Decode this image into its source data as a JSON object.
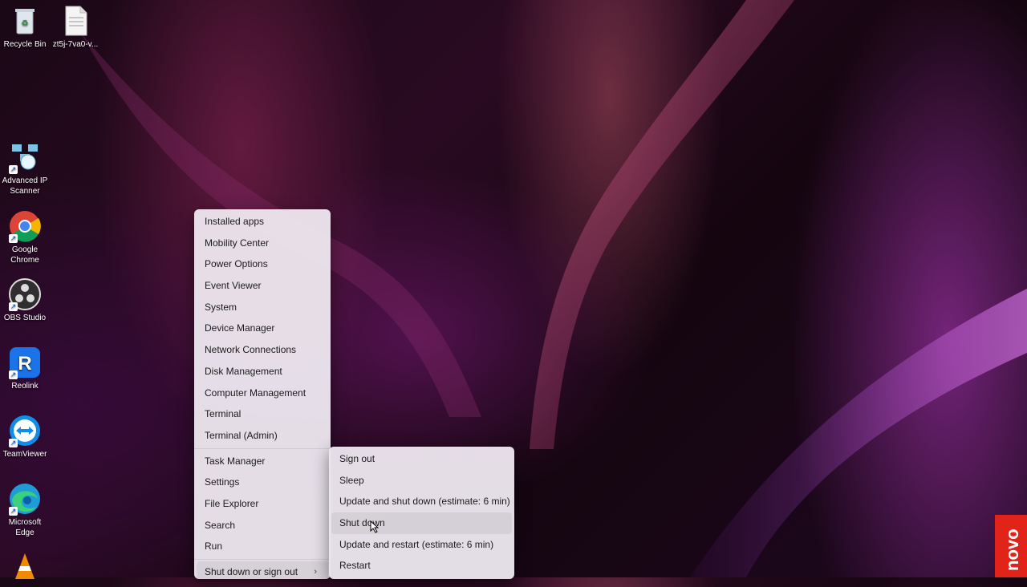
{
  "desktop": {
    "icons": [
      {
        "label": "Recycle Bin",
        "icon": "recycle-bin-icon"
      },
      {
        "label": "zt5j-7va0-v...",
        "icon": "text-file-icon"
      },
      {
        "label": "Advanced IP Scanner",
        "icon": "network-scanner-icon"
      },
      {
        "label": "Google Chrome",
        "icon": "chrome-icon"
      },
      {
        "label": "OBS Studio",
        "icon": "obs-icon"
      },
      {
        "label": "Reolink",
        "icon": "reolink-icon"
      },
      {
        "label": "TeamViewer",
        "icon": "teamviewer-icon"
      },
      {
        "label": "Microsoft Edge",
        "icon": "edge-icon"
      },
      {
        "label": "",
        "icon": "vlc-icon"
      }
    ]
  },
  "quick_link_menu": {
    "items": [
      "Installed apps",
      "Mobility Center",
      "Power Options",
      "Event Viewer",
      "System",
      "Device Manager",
      "Network Connections",
      "Disk Management",
      "Computer Management",
      "Terminal",
      "Terminal (Admin)",
      "Task Manager",
      "Settings",
      "File Explorer",
      "Search",
      "Run",
      "Shut down or sign out"
    ]
  },
  "shutdown_submenu": {
    "items": [
      "Sign out",
      "Sleep",
      "Update and shut down (estimate: 6 min)",
      "Shut down",
      "Update and restart (estimate: 6 min)",
      "Restart"
    ],
    "hovered": "Shut down"
  },
  "watermark": {
    "text": "novo",
    "color": "#e2231a"
  }
}
